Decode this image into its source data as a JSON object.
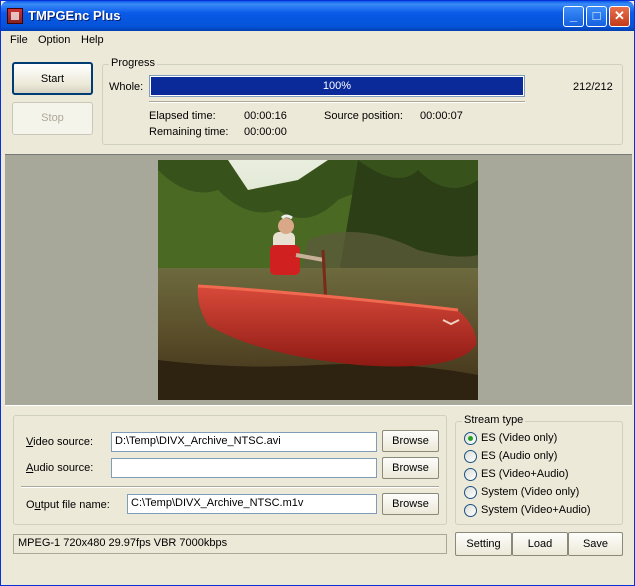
{
  "window": {
    "title": "TMPGEnc Plus",
    "controls": {
      "minimize": "_",
      "maximize": "□",
      "close": "✕"
    }
  },
  "menu": [
    "File",
    "Option",
    "Help"
  ],
  "buttons": {
    "start": "Start",
    "stop": "Stop"
  },
  "progress": {
    "group_label": "Progress",
    "whole_label": "Whole:",
    "percent_text": "100%",
    "fraction": 1.0,
    "count": "212/212",
    "elapsed_label": "Elapsed time:",
    "elapsed_value": "00:00:16",
    "remaining_label": "Remaining time:",
    "remaining_value": "00:00:00",
    "source_pos_label": "Source position:",
    "source_pos_value": "00:00:07"
  },
  "sources": {
    "video_label_underline": "V",
    "video_label_rest": "ideo source:",
    "video_value": "D:\\Temp\\DIVX_Archive_NTSC.avi",
    "audio_label_underline": "A",
    "audio_label_rest": "udio source:",
    "audio_value": "",
    "output_label_pre": "O",
    "output_label_underline": "u",
    "output_label_rest": "tput file name:",
    "output_value": "C:\\Temp\\DIVX_Archive_NTSC.m1v",
    "browse": "Browse"
  },
  "stream_type": {
    "label": "Stream type",
    "options": [
      "ES (Video only)",
      "ES (Audio only)",
      "ES (Video+Audio)",
      "System (Video only)",
      "System (Video+Audio)"
    ],
    "selected": "ES (Video only)"
  },
  "status": "MPEG-1 720x480 29.97fps VBR 7000kbps",
  "actions": {
    "setting": "Setting",
    "load": "Load",
    "save": "Save"
  },
  "colors": {
    "progress_fill": "#0a2a9a",
    "titlebar": "#0a5ae8",
    "radio_selected": "#21a121"
  }
}
